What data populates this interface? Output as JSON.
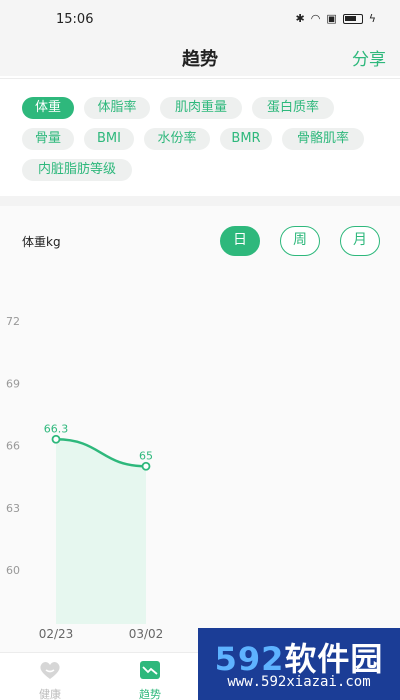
{
  "status": {
    "time": "15:06"
  },
  "header": {
    "title": "趋势",
    "share_label": "分享"
  },
  "metrics": {
    "items": [
      {
        "label": "体重",
        "active": true
      },
      {
        "label": "体脂率",
        "active": false
      },
      {
        "label": "肌肉重量",
        "active": false
      },
      {
        "label": "蛋白质率",
        "active": false
      },
      {
        "label": "骨量",
        "active": false
      },
      {
        "label": "BMI",
        "active": false
      },
      {
        "label": "水份率",
        "active": false
      },
      {
        "label": "BMR",
        "active": false
      },
      {
        "label": "骨骼肌率",
        "active": false
      },
      {
        "label": "内脏脂肪等级",
        "active": false
      }
    ]
  },
  "chart_panel": {
    "label": "体重kg",
    "periods": [
      {
        "label": "日",
        "active": true
      },
      {
        "label": "周",
        "active": false
      },
      {
        "label": "月",
        "active": false
      }
    ]
  },
  "chart_data": {
    "type": "area",
    "title": "",
    "ylabel": "体重kg",
    "xlabel": "",
    "x": [
      "02/23",
      "03/02"
    ],
    "yticks": [
      72,
      69,
      66,
      63,
      60
    ],
    "ylim": [
      57,
      75
    ],
    "series": [
      {
        "values": [
          66.3,
          65
        ],
        "labels": [
          "66.3",
          "65"
        ]
      }
    ],
    "colors": {
      "line": "#2eb87c",
      "fill": "#e6f7ef"
    },
    "grid": false
  },
  "tabbar": {
    "health_label": "健康",
    "trend_label": "趋势"
  },
  "watermark": {
    "logo_num": "592",
    "logo_text": "软件园",
    "url": "www.592xiazai.com"
  },
  "colors": {
    "accent": "#2eb87c",
    "chip_bg": "#eef0ef"
  }
}
